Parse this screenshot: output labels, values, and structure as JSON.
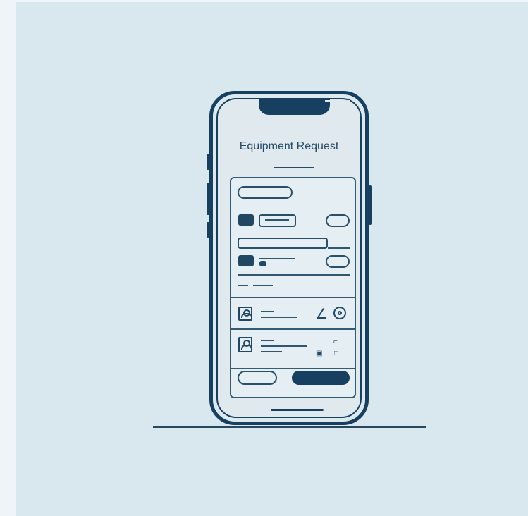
{
  "screen": {
    "title": "Equipment Request"
  },
  "icons": {
    "profile": "profile-icon",
    "document": "document-icon",
    "target": "target-icon",
    "edit": "edit-icon"
  },
  "colors": {
    "background": "#d9e8ef",
    "phone": "#173f5f",
    "accent": "#214863"
  }
}
